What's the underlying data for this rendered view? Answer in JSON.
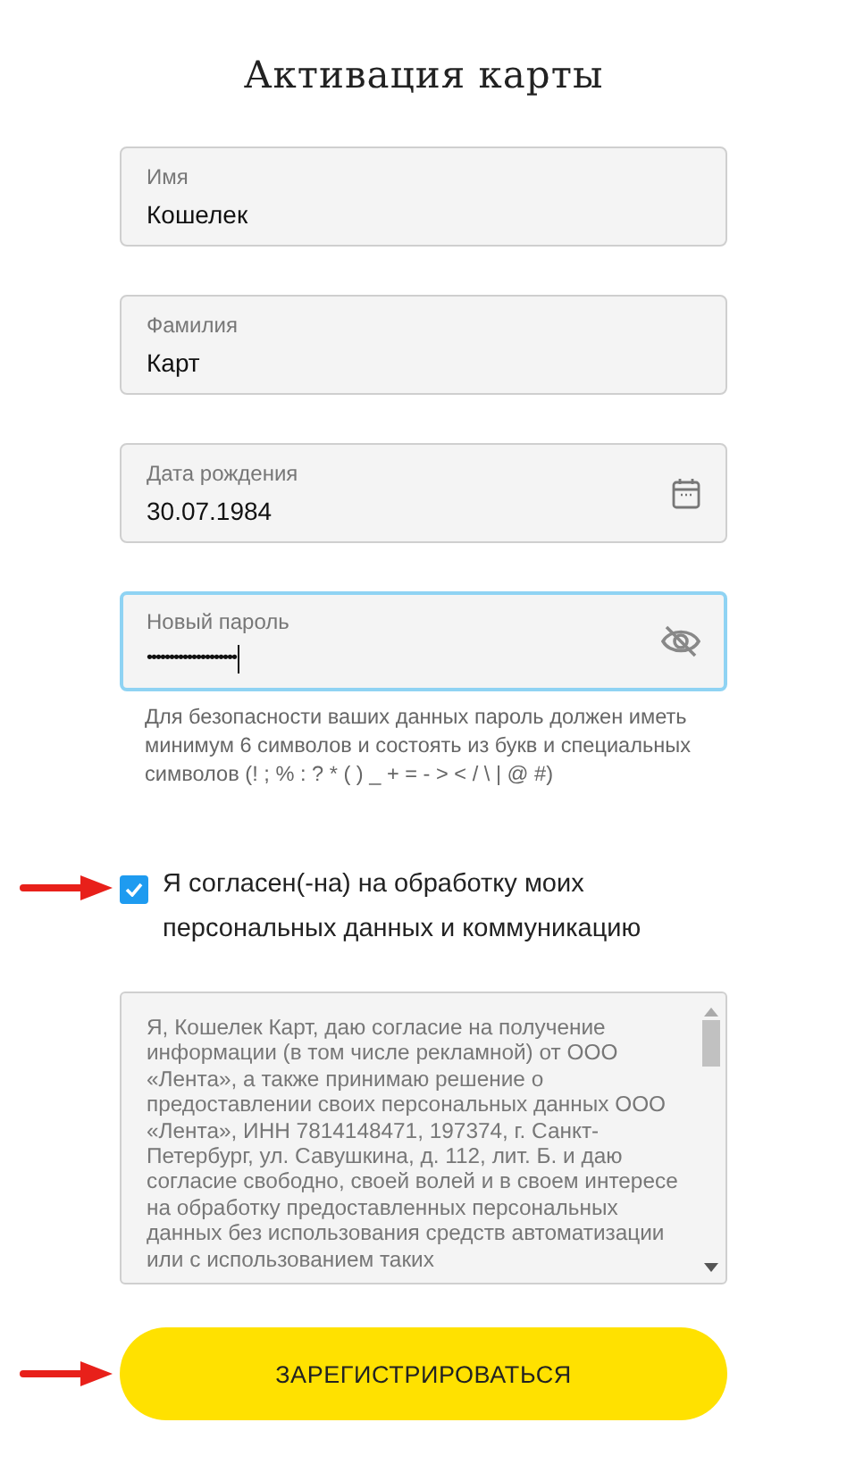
{
  "title": "Активация карты",
  "fields": [
    {
      "kind": "text",
      "label": "Имя",
      "value": "Кошелек",
      "focused": false
    },
    {
      "kind": "text",
      "label": "Фамилия",
      "value": "Карт",
      "focused": false
    },
    {
      "kind": "date",
      "label": "Дата рождения",
      "value": "30.07.1984",
      "focused": false
    },
    {
      "kind": "password",
      "label": "Новый пароль",
      "value": "••••••••••••••••••••",
      "focused": true,
      "hint": "Для безопасности ваших данных пароль должен иметь минимум 6 символов и состоять из букв и специальных символов (! ; % : ? * ( ) _ + = - > < / \\ | @ #)"
    }
  ],
  "consent": {
    "checked": true,
    "pointer_arrow": true,
    "label": "Я согласен(-на) на обработку моих персональных данных и коммуникацию"
  },
  "agreement_text": "Я, Кошелек Карт, даю согласие на получение информации (в том числе рекламной) от ООО «Лента», а также принимаю решение о предоставлении своих персональных данных ООО «Лента», ИНН 7814148471, 197374, г. Санкт-Петербург, ул. Савушкина, д. 112, лит. Б. и даю согласие свободно, своей волей и в своем интересе на обработку предоставленных персональных данных без использования средств автоматизации или с использованием таких",
  "submit_button": {
    "label": "ЗАРЕГИСТРИРОВАТЬСЯ",
    "pointer_arrow": true
  }
}
